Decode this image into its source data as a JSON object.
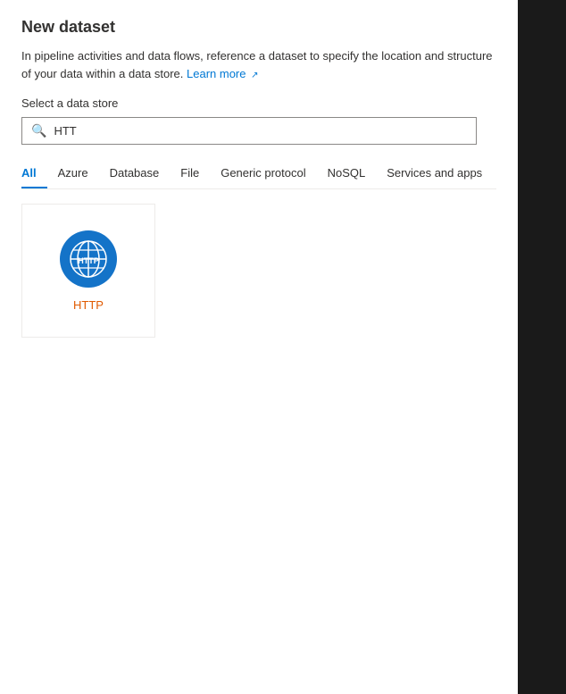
{
  "page": {
    "title": "New dataset",
    "description_part1": "In pipeline activities and data flows, reference a dataset to specify the location and structure of your data within a data store.",
    "learn_more_text": "Learn more",
    "section_label": "Select a data store"
  },
  "search": {
    "placeholder": "HTT",
    "value": "HTT"
  },
  "tabs": [
    {
      "id": "all",
      "label": "All",
      "active": true
    },
    {
      "id": "azure",
      "label": "Azure",
      "active": false
    },
    {
      "id": "database",
      "label": "Database",
      "active": false
    },
    {
      "id": "file",
      "label": "File",
      "active": false
    },
    {
      "id": "generic-protocol",
      "label": "Generic protocol",
      "active": false
    },
    {
      "id": "nosql",
      "label": "NoSQL",
      "active": false
    },
    {
      "id": "services-and-apps",
      "label": "Services and apps",
      "active": false
    }
  ],
  "connectors": [
    {
      "id": "http",
      "name": "HTTP",
      "icon_color": "#1473c8"
    }
  ],
  "colors": {
    "active_tab": "#0078d4",
    "connector_name": "#e05a00",
    "icon_bg": "#1473c8"
  }
}
